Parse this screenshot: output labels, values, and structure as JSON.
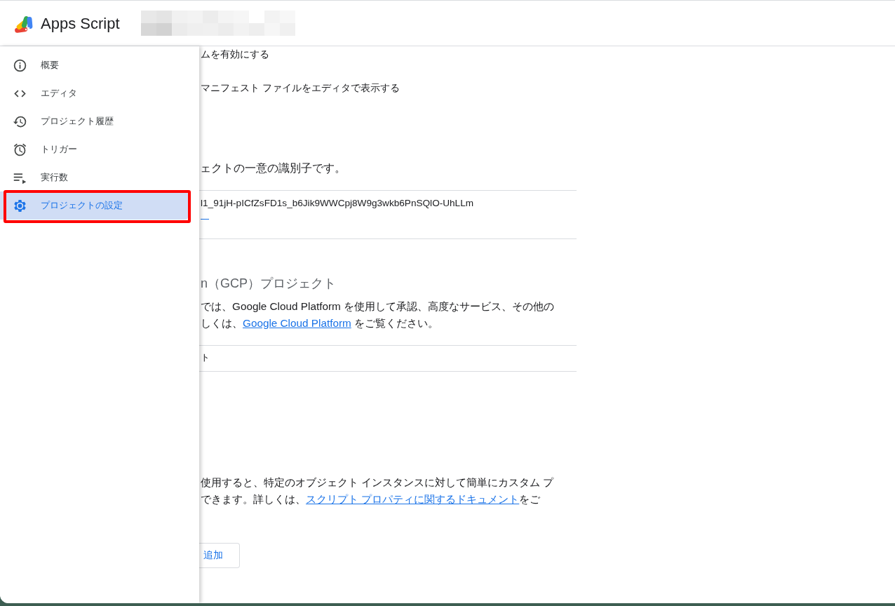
{
  "header": {
    "app_name": "Apps Script"
  },
  "nav": {
    "items": [
      {
        "kind": "overview",
        "label": "概要",
        "selected": false,
        "highlighted": false
      },
      {
        "kind": "editor",
        "label": "エディタ",
        "selected": false,
        "highlighted": false
      },
      {
        "kind": "history",
        "label": "プロジェクト履歴",
        "selected": false,
        "highlighted": false
      },
      {
        "kind": "triggers",
        "label": "トリガー",
        "selected": false,
        "highlighted": false
      },
      {
        "kind": "executions",
        "label": "実行数",
        "selected": false,
        "highlighted": false
      },
      {
        "kind": "settings",
        "label": "プロジェクトの設定",
        "selected": true,
        "highlighted": true
      }
    ]
  },
  "general_options": [
    "ムを有効にする",
    "マニフェスト ファイルをエディタで表示する"
  ],
  "ids_section": {
    "description": "ェクトの一意の識別子です。",
    "script_id": "l1_91jH-pICfZsFD1s_b6Jik9WWCpj8W9g3wkb6PnSQlO-UhLLm"
  },
  "gcp_section": {
    "heading": "n（GCP）プロジェクト",
    "paragraph": [
      [
        {
          "text": "では、Google Cloud Platform を使用して承認、高度なサービス、その他の"
        }
      ],
      [
        {
          "text": "しくは、"
        },
        {
          "text": "Google Cloud Platform",
          "link": true
        },
        {
          "text": " をご覧ください。"
        }
      ]
    ],
    "field_label": "ト"
  },
  "properties_section": {
    "paragraph": [
      [
        {
          "text": "使用すると、特定のオブジェクト インスタンスに対して簡単にカスタム プ"
        }
      ],
      [
        {
          "text": "できます。詳しくは、"
        },
        {
          "text": "スクリプト プロパティに関するドキュメント",
          "link": true
        },
        {
          "text": "をご"
        }
      ]
    ],
    "add_button": "追加"
  }
}
